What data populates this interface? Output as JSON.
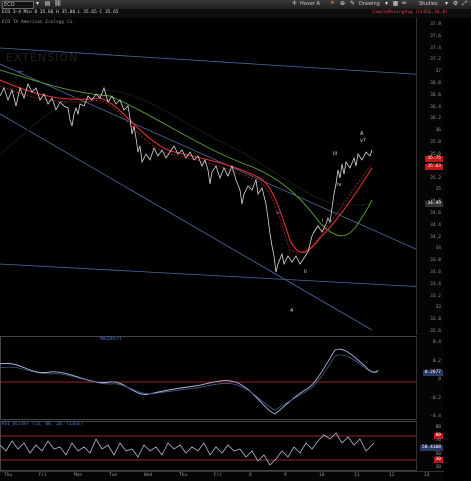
{
  "toolbar": {
    "symbol": "ECO",
    "center_label": "Hover A",
    "drawing_label": "Drawing",
    "studies_label": "Studies"
  },
  "info": {
    "price_line": "ECO  3-4 Min  O 35.66  H 35.86  L 35.65  C 35.65",
    "study_line": "SimpleMovingAvg (CLOSE,34,0)",
    "company": "ECO  TA  American  Ecology  Co.",
    "watermark": "EXTENSION"
  },
  "price_axis": {
    "ticks": [
      "37.8",
      "37.6",
      "37.4",
      "37.2",
      "37",
      "36.8",
      "36.6",
      "36.4",
      "36.2",
      "36",
      "35.8",
      "35.6",
      "35.4",
      "35.2",
      "35",
      "34.8",
      "34.6",
      "34.4",
      "34.2",
      "34",
      "33.8",
      "33.6",
      "33.4",
      "33.2",
      "33",
      "32.8",
      "32.6"
    ],
    "tag_last": "35.75",
    "tag_ma1": "35.63",
    "tag_ma2": "34.99"
  },
  "wave_labels": {
    "a": "A",
    "v": "v?",
    "iii": "iii",
    "iv": "iv",
    "ii": "ii",
    "four": "4",
    "one": "i"
  },
  "macd": {
    "header": "MACDHist",
    "ticks": [
      "0.4",
      "0.2",
      "0",
      "-0.2",
      "-0.4"
    ],
    "tag": "0.2677"
  },
  "rsi": {
    "header": "RSI_Wilder (14, 80, 20, CLOSE)",
    "ticks": [
      "80",
      "70",
      "50",
      "30"
    ],
    "tag_upper": "80",
    "tag_value": "58.4108",
    "tag_lower": "30"
  },
  "x_axis": [
    "Thu",
    "Fri",
    "Mon",
    "Tue",
    "Wed",
    "Thu",
    "Fri",
    "8",
    "9",
    "10",
    "11",
    "12",
    "13"
  ],
  "colors": {
    "price": "#d8d8d8",
    "ma_red": "#e03030",
    "ma_green": "#5aa02c",
    "ma_black": "#111111",
    "channel": "#4a6aa0",
    "hline": "#8aa0c8",
    "band_red": "#d03030"
  }
}
